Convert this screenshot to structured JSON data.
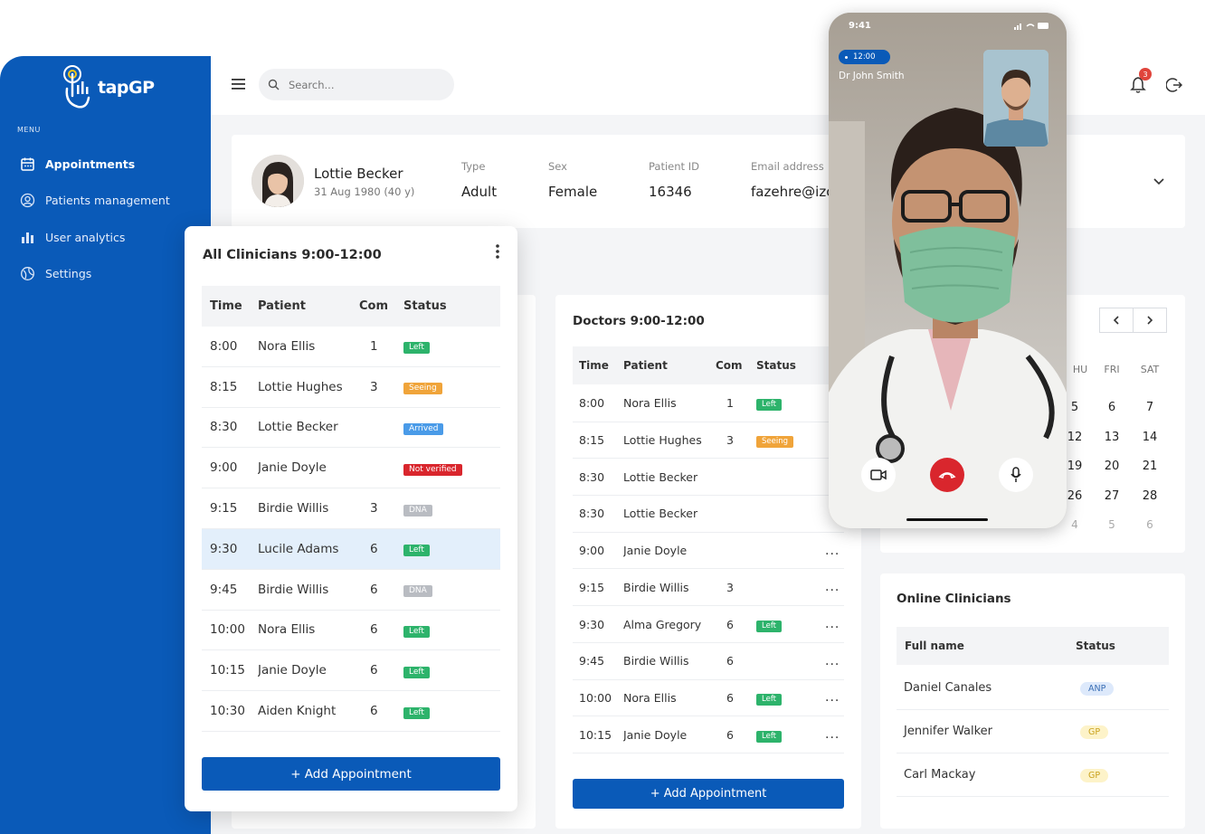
{
  "app": {
    "brand_prefix": "tap",
    "brand_suffix": "GP"
  },
  "sidebar": {
    "menu_label": "MENU",
    "items": [
      {
        "label": "Appointments",
        "icon": "calendar-icon",
        "active": true
      },
      {
        "label": "Patients management",
        "icon": "user-circle-icon"
      },
      {
        "label": "User analytics",
        "icon": "bar-chart-icon"
      },
      {
        "label": "Settings",
        "icon": "settings-icon"
      }
    ]
  },
  "header": {
    "search_placeholder": "Search...",
    "notification_count": "3"
  },
  "patient": {
    "name": "Lottie Becker",
    "dob": "31 Aug 1980 (40 y)",
    "fields": [
      {
        "label": "Type",
        "value": "Adult"
      },
      {
        "label": "Sex",
        "value": "Female"
      },
      {
        "label": "Patient ID",
        "value": "16346"
      },
      {
        "label": "Email address",
        "value": "fazehre@izc"
      }
    ]
  },
  "all_clinicians": {
    "title": "All Clinicians 9:00-12:00",
    "columns": [
      "Time",
      "Patient",
      "Com",
      "Status"
    ],
    "rows": [
      {
        "time": "8:00",
        "patient": "Nora Ellis",
        "com": "1",
        "status": "Left"
      },
      {
        "time": "8:15",
        "patient": "Lottie Hughes",
        "com": "3",
        "status": "Seeing"
      },
      {
        "time": "8:30",
        "patient": "Lottie Becker",
        "com": "",
        "status": "Arrived"
      },
      {
        "time": "9:00",
        "patient": "Janie Doyle",
        "com": "",
        "status": "Not verified"
      },
      {
        "time": "9:15",
        "patient": "Birdie Willis",
        "com": "3",
        "status": "DNA"
      },
      {
        "time": "9:30",
        "patient": "Lucile Adams",
        "com": "6",
        "status": "Left"
      },
      {
        "time": "9:45",
        "patient": "Birdie Willis",
        "com": "6",
        "status": "DNA"
      },
      {
        "time": "10:00",
        "patient": "Nora Ellis",
        "com": "6",
        "status": "Left"
      },
      {
        "time": "10:15",
        "patient": "Janie Doyle",
        "com": "6",
        "status": "Left"
      },
      {
        "time": "10:30",
        "patient": "Aiden Knight",
        "com": "6",
        "status": "Left"
      }
    ],
    "add_label": "+ Add Appointment"
  },
  "doctors": {
    "title": "Doctors 9:00-12:00",
    "columns": [
      "Time",
      "Patient",
      "Com",
      "Status"
    ],
    "rows": [
      {
        "time": "8:00",
        "patient": "Nora Ellis",
        "com": "1",
        "status": "Left",
        "more": ""
      },
      {
        "time": "8:15",
        "patient": "Lottie Hughes",
        "com": "3",
        "status": "Seeing",
        "more": ""
      },
      {
        "time": "8:30",
        "patient": "Lottie Becker",
        "com": "",
        "status": "",
        "more": ""
      },
      {
        "time": "8:30",
        "patient": "Lottie Becker",
        "com": "",
        "status": "",
        "more": ""
      },
      {
        "time": "9:00",
        "patient": "Janie Doyle",
        "com": "",
        "status": "",
        "more": "..."
      },
      {
        "time": "9:15",
        "patient": "Birdie Willis",
        "com": "3",
        "status": "",
        "more": "..."
      },
      {
        "time": "9:30",
        "patient": "Alma Gregory",
        "com": "6",
        "status": "Left",
        "more": "..."
      },
      {
        "time": "9:45",
        "patient": "Birdie Willis",
        "com": "6",
        "status": "",
        "more": "..."
      },
      {
        "time": "10:00",
        "patient": "Nora Ellis",
        "com": "6",
        "status": "Left",
        "more": "..."
      },
      {
        "time": "10:15",
        "patient": "Janie Doyle",
        "com": "6",
        "status": "Left",
        "more": "..."
      }
    ],
    "add_label": "+ Add Appointment"
  },
  "calendar": {
    "headers": [
      "HU",
      "FRI",
      "SAT"
    ],
    "weeks": [
      [
        "5",
        "6",
        "7"
      ],
      [
        "12",
        "13",
        "14"
      ],
      [
        "19",
        "20",
        "21"
      ],
      [
        "26",
        "27",
        "28"
      ],
      [
        "4",
        "5",
        "6"
      ]
    ]
  },
  "online_clinicians": {
    "title": "Online Clinicians",
    "columns": [
      "Full name",
      "Status"
    ],
    "rows": [
      {
        "name": "Daniel Canales",
        "role": "ANP"
      },
      {
        "name": "Jennifer Walker",
        "role": "GP"
      },
      {
        "name": "Carl Mackay",
        "role": "GP"
      }
    ]
  },
  "phone": {
    "clock": "9:41",
    "call_time": "12:00",
    "caller": "Dr John Smith"
  },
  "status_colors": {
    "Left": "#2db36b",
    "Seeing": "#f0a43a",
    "Arrived": "#4a9be8",
    "Not verified": "#d9262d",
    "DNA": "#b9bcc2"
  },
  "role_colors": {
    "ANP": "#dde9fb",
    "GP": "#fdf3c9"
  }
}
